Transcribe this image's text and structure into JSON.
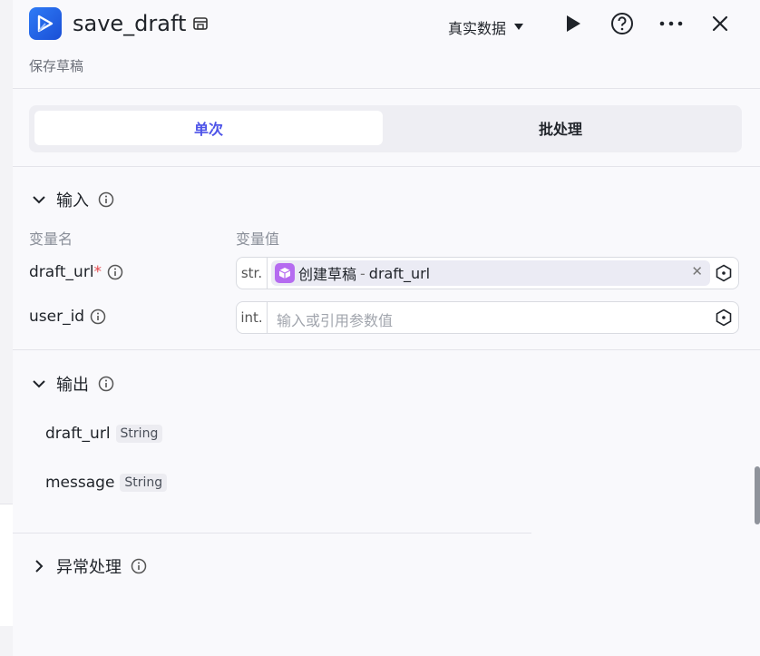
{
  "header": {
    "title": "save_draft",
    "subtitle": "保存草稿",
    "data_mode": "真实数据"
  },
  "tabs": [
    {
      "label": "单次",
      "active": true
    },
    {
      "label": "批处理",
      "active": false
    }
  ],
  "input_section": {
    "title": "输入",
    "col_name": "变量名",
    "col_value": "变量值",
    "params": [
      {
        "name": "draft_url",
        "required_mark": "*",
        "type": "str.",
        "ref_node": "创建草稿",
        "ref_sep": "-",
        "ref_field": "draft_url"
      },
      {
        "name": "user_id",
        "type": "int.",
        "placeholder": "输入或引用参数值"
      }
    ]
  },
  "output_section": {
    "title": "输出",
    "outputs": [
      {
        "name": "draft_url",
        "type": "String"
      },
      {
        "name": "message",
        "type": "String"
      }
    ]
  },
  "exception_section": {
    "title": "异常处理"
  },
  "colors": {
    "accent": "#4d53e8",
    "chip_icon": "#b56bf0",
    "app_icon": "#2f7bf6"
  }
}
